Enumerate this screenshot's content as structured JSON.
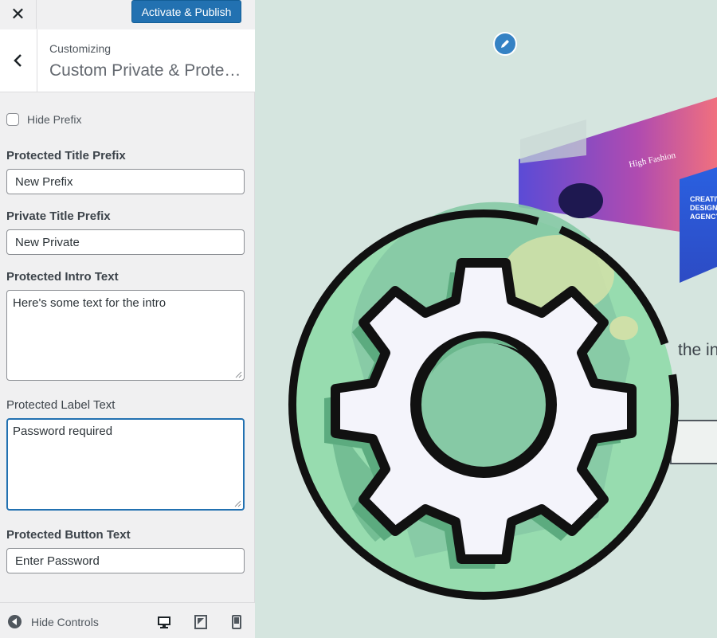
{
  "topbar": {
    "close_icon": "close-icon",
    "publish_label": "Activate & Publish"
  },
  "header": {
    "back_icon": "chevron-left-icon",
    "customizing_label": "Customizing",
    "panel_title": "Custom Private & Protect..."
  },
  "controls": {
    "hide_prefix": {
      "label": "Hide Prefix",
      "checked": false
    },
    "protected_title_prefix": {
      "label": "Protected Title Prefix",
      "value": "New Prefix"
    },
    "private_title_prefix": {
      "label": "Private Title Prefix",
      "value": "New Private"
    },
    "protected_intro_text": {
      "label": "Protected Intro Text",
      "value": "Here's some text for the intro"
    },
    "protected_label_text": {
      "label": "Protected Label Text",
      "value": "Password required"
    },
    "protected_button_text": {
      "label": "Protected Button Text",
      "value": "Enter Password"
    }
  },
  "footer": {
    "hide_controls_label": "Hide Controls",
    "devices": [
      "desktop-icon",
      "tablet-icon",
      "mobile-icon"
    ]
  },
  "preview": {
    "partial_text": "the in",
    "hero_heading": "High Fashion",
    "card_text": "CREATIVE DESIGN AGENCY",
    "accent_color": "#3582c4"
  },
  "colors": {
    "primary": "#2271b1",
    "gear_green": "#86cba5",
    "gear_outline": "#111111"
  }
}
